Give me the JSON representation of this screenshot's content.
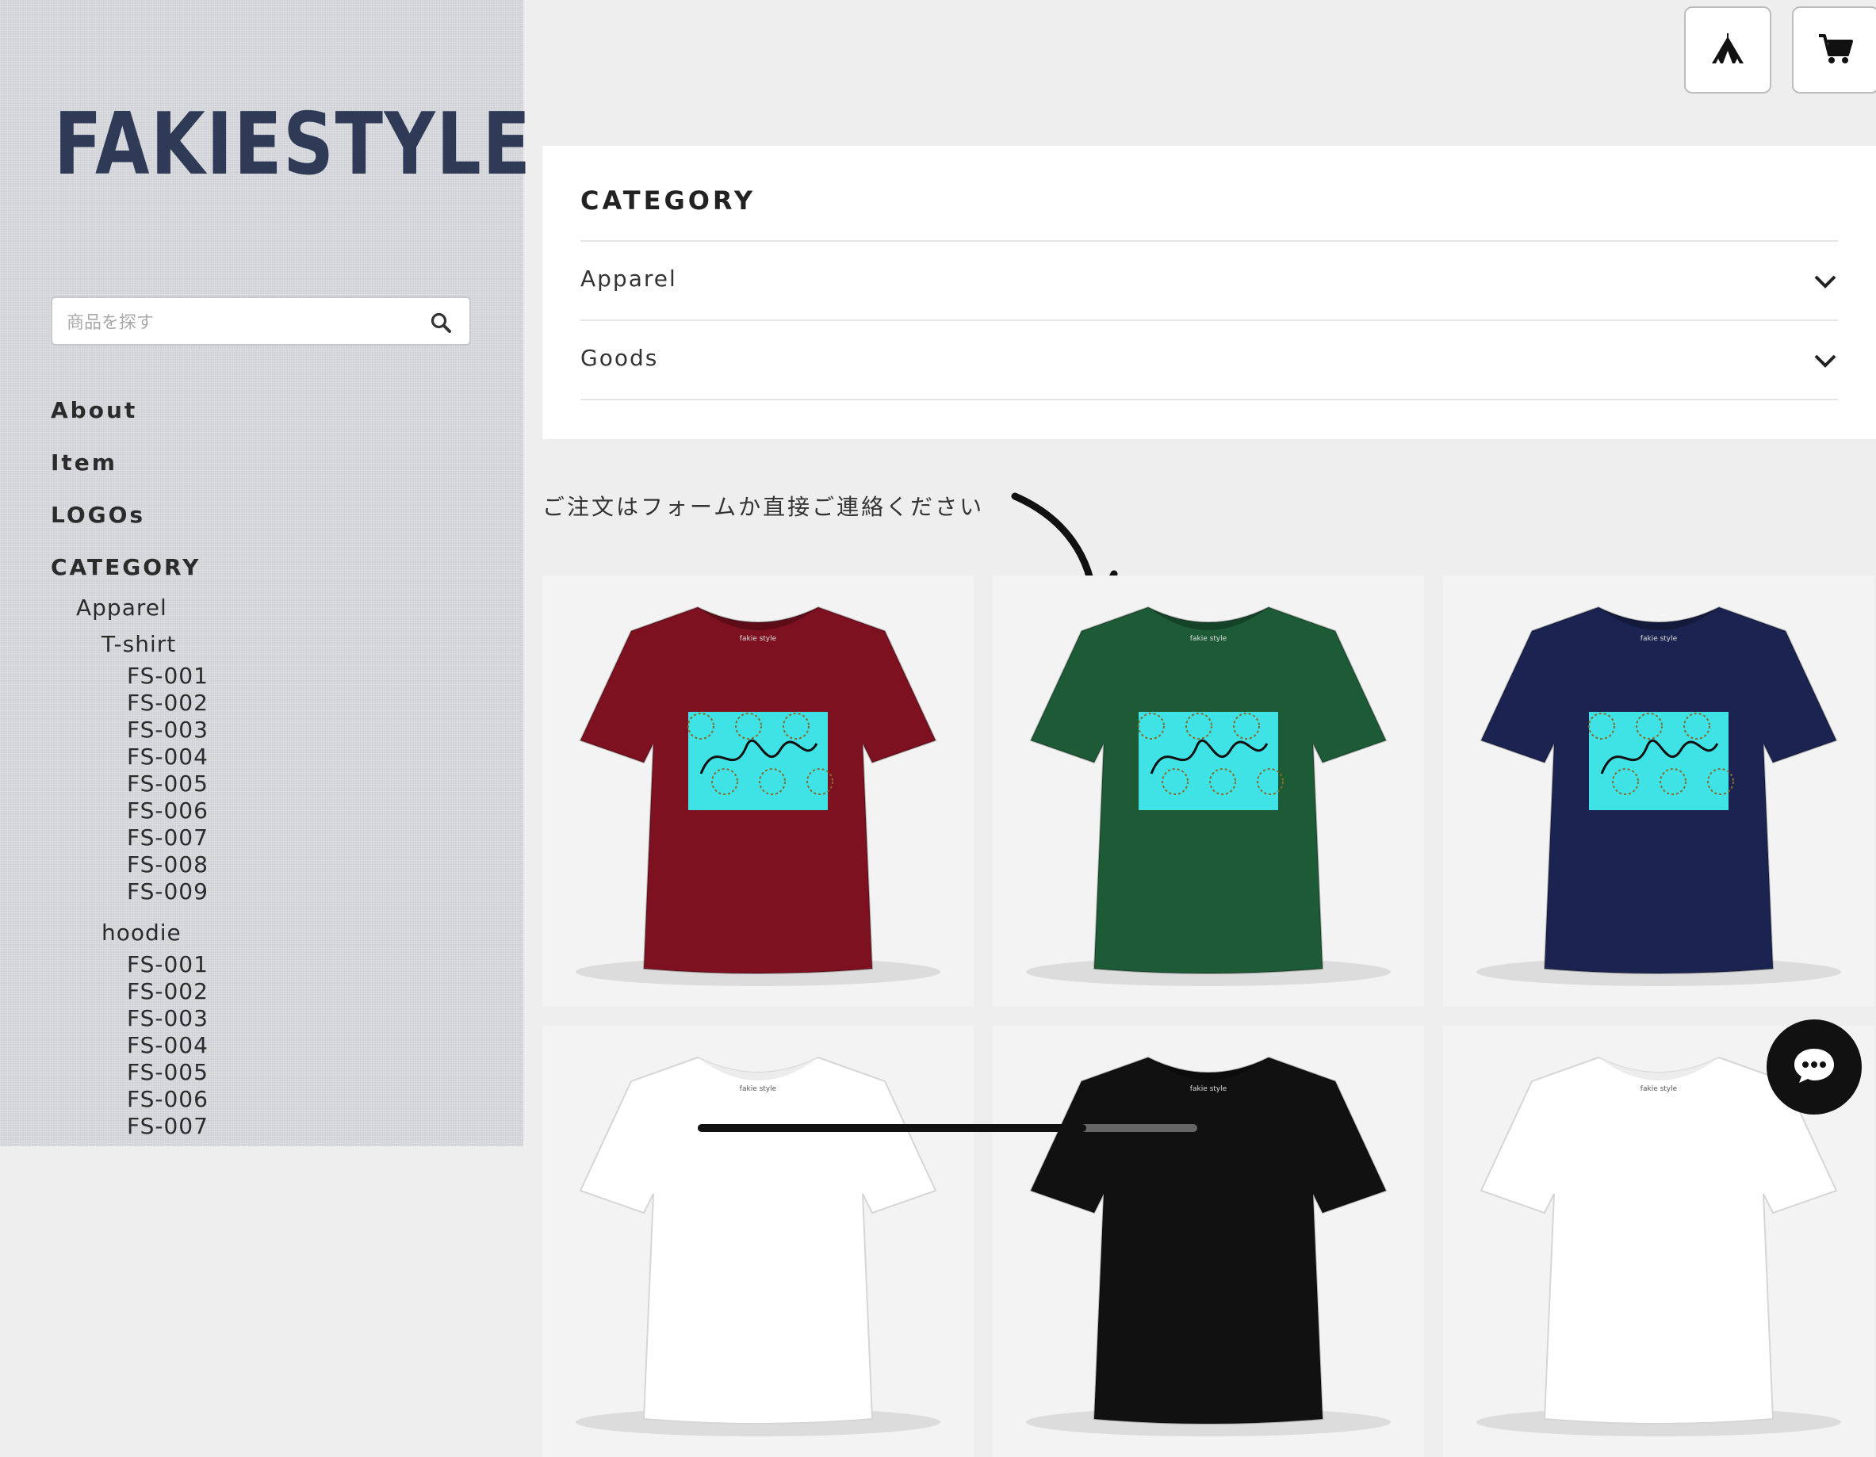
{
  "brand": {
    "logo_text": "FAKIESTYLE"
  },
  "search": {
    "placeholder": "商品を探す"
  },
  "nav": {
    "about": "About",
    "item": "Item",
    "logos": "LOGOs",
    "category": "CATEGORY",
    "apparel": "Apparel",
    "tshirt": "T-shirt",
    "tshirt_items": [
      "FS-001",
      "FS-002",
      "FS-003",
      "FS-004",
      "FS-005",
      "FS-006",
      "FS-007",
      "FS-008",
      "FS-009"
    ],
    "hoodie": "hoodie",
    "hoodie_items": [
      "FS-001",
      "FS-002",
      "FS-003",
      "FS-004",
      "FS-005",
      "FS-006",
      "FS-007"
    ]
  },
  "top_buttons": {
    "home_icon": "tent-icon",
    "cart_icon": "cart-icon"
  },
  "category_card": {
    "title": "CATEGORY",
    "rows": [
      {
        "label": "Apparel"
      },
      {
        "label": "Goods"
      }
    ]
  },
  "notice": "ご注文はフォームか直接ご連絡ください",
  "products": [
    {
      "shirt_color": "#7d1120",
      "print": true
    },
    {
      "shirt_color": "#1d5a36",
      "print": true
    },
    {
      "shirt_color": "#1b2350",
      "print": true
    },
    {
      "shirt_color": "#ffffff",
      "print": false
    },
    {
      "shirt_color": "#111111",
      "print": false
    },
    {
      "shirt_color": "#ffffff",
      "print": false
    }
  ],
  "print_color": "#3fe3e6",
  "shirt_brand_label": "fakie style",
  "chat_icon": "chat-bubble-icon"
}
